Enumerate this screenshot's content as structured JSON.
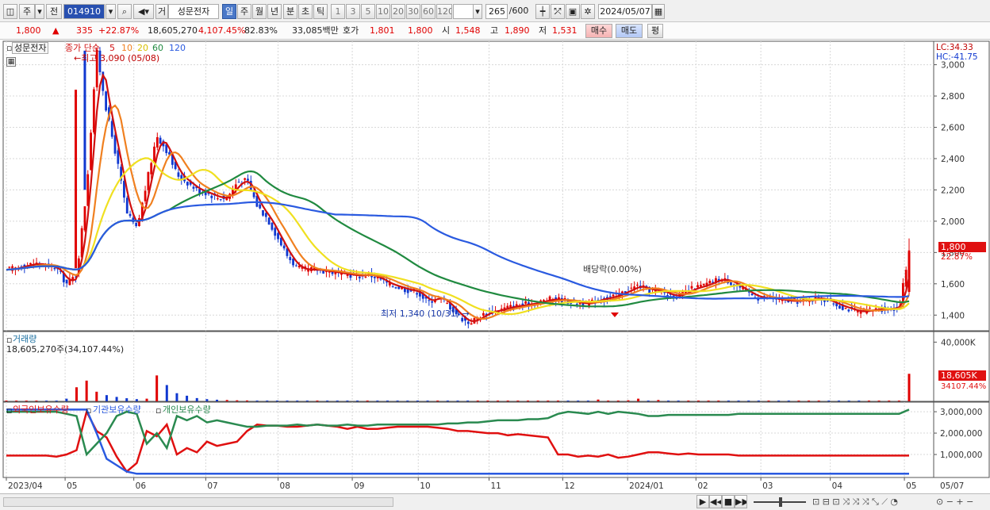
{
  "toolbar": {
    "main_label": "주",
    "prev_label": "전",
    "code": "014910",
    "name": "성문전자",
    "mode_label": "거",
    "periods": [
      "일",
      "주",
      "월",
      "년",
      "분",
      "초",
      "틱"
    ],
    "selected_period": "일",
    "intervals": [
      "1",
      "3",
      "5",
      "10",
      "20",
      "30",
      "60",
      "120"
    ],
    "count": "265",
    "count_total": "/600",
    "date": "2024/05/07"
  },
  "quote": {
    "price": "1,800",
    "arrow": "▲",
    "change": "335",
    "change_pct": "+22.87%",
    "volume": "18,605,270",
    "volume_pct": "4,107.45%",
    "turnover_pct": "82.83%",
    "amount": "33,085백만",
    "ask_label": "호가",
    "ask1": "1,801",
    "ask2": "1,800",
    "open_label": "시",
    "open": "1,548",
    "high_label": "고",
    "high": "1,890",
    "low_label": "저",
    "low": "1,531",
    "buy_label": "매수",
    "sell_label": "매도",
    "eval_label": "평"
  },
  "price_panel": {
    "title": "성문전자",
    "ma_title": "종가 단순",
    "ma_periods": [
      "5",
      "10",
      "20",
      "60",
      "120"
    ],
    "lc": "LC:34.33",
    "hc": "HC:-41.75",
    "high_marker": "최고 3,090 (05/08)",
    "low_marker": "최저 1,340 (10/31)",
    "dividend_marker": "배당락(0.00%)",
    "price_badge": "1,800",
    "price_badge_pct": "22.87%"
  },
  "volume_panel": {
    "title": "거래량",
    "subtitle": "18,605,270주(34,107.44%)",
    "badge": "18,605K",
    "badge_sub": "34107.44%"
  },
  "holdings_panel": {
    "series_labels": [
      "외국인보유수량",
      "기관보유수량",
      "개인보유수량"
    ]
  },
  "colors": {
    "up": "#e00000",
    "down": "#1038d0",
    "ma5": "#d01010",
    "ma10": "#f08020",
    "ma20": "#f0e020",
    "ma60": "#208a40",
    "ma120": "#2a5ae0",
    "foreign": "#e01010",
    "institution": "#2a5ae0",
    "individual": "#2a8a50"
  },
  "chart_data": [
    {
      "type": "candlestick",
      "title": "성문전자",
      "ylim": [
        1300,
        3150
      ],
      "yticks": [
        1400,
        1600,
        1800,
        2000,
        2200,
        2400,
        2600,
        2800,
        3000
      ],
      "x_tick_labels": [
        "2023/04",
        "05",
        "06",
        "07",
        "08",
        "09",
        "10",
        "11",
        "12",
        "2024/01",
        "02",
        "03",
        "04",
        "05",
        "05/07"
      ],
      "series": [
        {
          "name": "close",
          "values": [
            1690,
            1700,
            1720,
            1730,
            1715,
            1700,
            1600,
            1660,
            2200,
            3090,
            2700,
            2400,
            2050,
            1950,
            2250,
            2550,
            2450,
            2300,
            2250,
            2200,
            2180,
            2150,
            2150,
            2250,
            2260,
            2100,
            2020,
            1900,
            1780,
            1700,
            1690,
            1690,
            1680,
            1670,
            1660,
            1650,
            1660,
            1640,
            1600,
            1580,
            1560,
            1550,
            1480,
            1520,
            1470,
            1400,
            1350,
            1380,
            1420,
            1430,
            1450,
            1460,
            1470,
            1480,
            1500,
            1500,
            1490,
            1480,
            1470,
            1500,
            1510,
            1530,
            1560,
            1590,
            1560,
            1560,
            1530,
            1520,
            1560,
            1580,
            1600,
            1630,
            1620,
            1580,
            1540,
            1510,
            1510,
            1500,
            1490,
            1490,
            1500,
            1510,
            1490,
            1460,
            1440,
            1420,
            1430,
            1440,
            1440,
            1450,
            1800
          ]
        }
      ],
      "ma": [
        "5",
        "10",
        "20",
        "60",
        "120"
      ],
      "annotations": [
        "최고 3,090 (05/08)",
        "최저 1,340 (10/31)",
        "배당락(0.00%)"
      ]
    },
    {
      "type": "bar",
      "title": "거래량",
      "ylim": [
        0,
        45000000
      ],
      "ytick_labels": [
        "40,000K"
      ],
      "series": [
        {
          "name": "거래량",
          "values": [
            120000,
            90000,
            150000,
            110000,
            80000,
            130000,
            1800000,
            9500000,
            14000000,
            6500000,
            4200000,
            3000000,
            2100000,
            1500000,
            1800000,
            17500000,
            11000000,
            5500000,
            3800000,
            2200000,
            1500000,
            1100000,
            900000,
            700000,
            600000,
            500000,
            450000,
            400000,
            380000,
            350000,
            330000,
            300000,
            280000,
            260000,
            250000,
            240000,
            230000,
            220000,
            200000,
            190000,
            180000,
            170000,
            160000,
            150000,
            140000,
            130000,
            120000,
            110000,
            100000,
            100000,
            90000,
            90000,
            80000,
            80000,
            80000,
            300000,
            70000,
            70000,
            70000,
            1200000,
            200000,
            150000,
            700000,
            1800000,
            400000,
            900000,
            300000,
            200000,
            250000,
            150000,
            120000,
            100000,
            100000,
            90000,
            90000,
            80000,
            80000,
            70000,
            70000,
            70000,
            60000,
            60000,
            60000,
            60000,
            60000,
            60000,
            60000,
            60000,
            60000,
            60000,
            18605270
          ]
        }
      ]
    },
    {
      "type": "line",
      "title": "보유수량",
      "ylim": [
        0,
        3300000
      ],
      "ytick_labels": [
        "1,000,000",
        "2,000,000",
        "3,000,000"
      ],
      "series": [
        {
          "name": "외국인보유수량",
          "values": [
            950000,
            950000,
            950000,
            950000,
            950000,
            900000,
            1000000,
            1200000,
            3000000,
            2100000,
            1800000,
            900000,
            200000,
            600000,
            2100000,
            1850000,
            2400000,
            1000000,
            1300000,
            1100000,
            1600000,
            1400000,
            1500000,
            1600000,
            2100000,
            2400000,
            2350000,
            2350000,
            2300000,
            2300000,
            2350000,
            2400000,
            2350000,
            2300000,
            2200000,
            2300000,
            2200000,
            2200000,
            2250000,
            2300000,
            2300000,
            2300000,
            2300000,
            2250000,
            2200000,
            2100000,
            2100000,
            2050000,
            2000000,
            2000000,
            1900000,
            1950000,
            1900000,
            1850000,
            1800000,
            1000000,
            1000000,
            900000,
            950000,
            900000,
            1000000,
            850000,
            900000,
            1000000,
            1100000,
            1100000,
            1050000,
            1000000,
            1050000,
            1000000,
            1000000,
            1000000,
            1000000,
            950000,
            950000,
            950000,
            950000,
            950000,
            950000,
            950000,
            950000,
            950000,
            950000,
            950000,
            950000,
            950000,
            950000,
            950000,
            950000,
            950000,
            950000
          ]
        },
        {
          "name": "기관보유수량",
          "values": [
            3100000,
            3100000,
            3100000,
            3100000,
            3100000,
            3100000,
            3100000,
            3100000,
            3100000,
            2000000,
            800000,
            500000,
            200000,
            100000,
            100000,
            100000,
            100000,
            100000,
            100000,
            100000,
            100000,
            100000,
            100000,
            100000,
            100000,
            100000,
            100000,
            100000,
            100000,
            100000,
            100000,
            100000,
            100000,
            100000,
            100000,
            100000,
            100000,
            100000,
            100000,
            100000,
            100000,
            100000,
            100000,
            100000,
            100000,
            100000,
            100000,
            100000,
            100000,
            100000,
            100000,
            100000,
            100000,
            100000,
            100000,
            100000,
            100000,
            100000,
            100000,
            100000,
            100000,
            100000,
            100000,
            100000,
            100000,
            100000,
            100000,
            100000,
            100000,
            100000,
            100000,
            100000,
            100000,
            100000,
            100000,
            100000,
            100000,
            100000,
            100000,
            100000,
            100000,
            100000,
            100000,
            100000,
            100000,
            100000,
            100000,
            100000,
            100000,
            100000,
            100000
          ]
        },
        {
          "name": "개인보유수량",
          "values": [
            3000000,
            3000000,
            3000000,
            3000000,
            3000000,
            3000000,
            2900000,
            2800000,
            1000000,
            1500000,
            2000000,
            2800000,
            3000000,
            2900000,
            1500000,
            2000000,
            1300000,
            2800000,
            2600000,
            2800000,
            2500000,
            2600000,
            2500000,
            2400000,
            2300000,
            2300000,
            2350000,
            2350000,
            2350000,
            2400000,
            2350000,
            2400000,
            2350000,
            2350000,
            2400000,
            2350000,
            2350000,
            2400000,
            2400000,
            2400000,
            2400000,
            2400000,
            2400000,
            2400000,
            2450000,
            2450000,
            2500000,
            2500000,
            2550000,
            2600000,
            2600000,
            2600000,
            2650000,
            2650000,
            2700000,
            2900000,
            3000000,
            2950000,
            2900000,
            3000000,
            2900000,
            3000000,
            2950000,
            2900000,
            2800000,
            2800000,
            2850000,
            2850000,
            2850000,
            2850000,
            2850000,
            2850000,
            2850000,
            2900000,
            2900000,
            2900000,
            2900000,
            2900000,
            2900000,
            2900000,
            2900000,
            2900000,
            2900000,
            2900000,
            2900000,
            2900000,
            2900000,
            2900000,
            2900000,
            2900000,
            3100000
          ]
        }
      ]
    }
  ]
}
